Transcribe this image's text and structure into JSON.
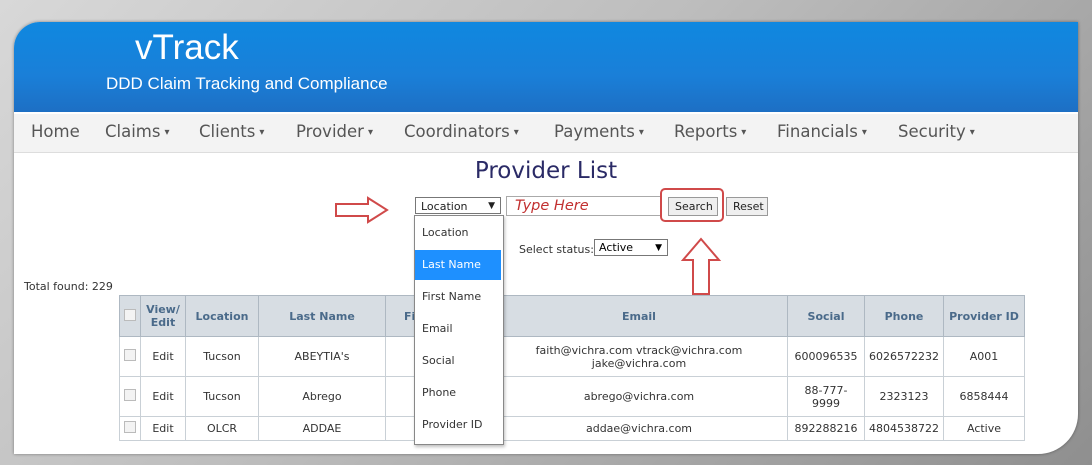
{
  "app": {
    "title": "vTrack",
    "tagline": "DDD Claim Tracking and Compliance"
  },
  "nav": [
    {
      "label": "Home",
      "has_caret": false
    },
    {
      "label": "Claims",
      "has_caret": true
    },
    {
      "label": "Clients",
      "has_caret": true
    },
    {
      "label": "Provider",
      "has_caret": true
    },
    {
      "label": "Coordinators",
      "has_caret": true
    },
    {
      "label": "Payments",
      "has_caret": true
    },
    {
      "label": "Reports",
      "has_caret": true
    },
    {
      "label": "Financials",
      "has_caret": true
    },
    {
      "label": "Security",
      "has_caret": true
    }
  ],
  "page": {
    "title": "Provider List"
  },
  "search": {
    "field_selected": "Location",
    "placeholder": "Type Here",
    "search_label": "Search",
    "reset_label": "Reset",
    "field_options": [
      "Location",
      "Last Name",
      "First Name",
      "Email",
      "Social",
      "Phone",
      "Provider ID"
    ],
    "highlighted_option": "Last Name"
  },
  "status": {
    "label": "Select status:",
    "value": "Active"
  },
  "total": "Total found: 229",
  "table": {
    "headers": [
      "",
      "View/ Edit",
      "Location",
      "Last Name",
      "First Name",
      "Email",
      "Social",
      "Phone",
      "Provider ID"
    ],
    "rows": [
      [
        "",
        "Edit",
        "Tucson",
        "ABEYTIA's",
        "",
        "faith@vichra.com vtrack@vichra.com jake@vichra.com",
        "600096535",
        "6026572232",
        "A001"
      ],
      [
        "",
        "Edit",
        "Tucson",
        "Abrego",
        "",
        "abrego@vichra.com",
        "88-777-9999",
        "2323123",
        "6858444"
      ],
      [
        "",
        "Edit",
        "OLCR",
        "ADDAE",
        "",
        "addae@vichra.com",
        "892288216",
        "4804538722",
        "Active"
      ]
    ]
  },
  "colors": {
    "header_blue": "#1a7fd8",
    "highlight": "#1e90ff",
    "annotation_red": "#d04a4a"
  },
  "icons": {
    "caret": "caret-down-icon",
    "arrow_right": "arrow-right-annotation-icon",
    "arrow_up": "arrow-up-annotation-icon"
  }
}
